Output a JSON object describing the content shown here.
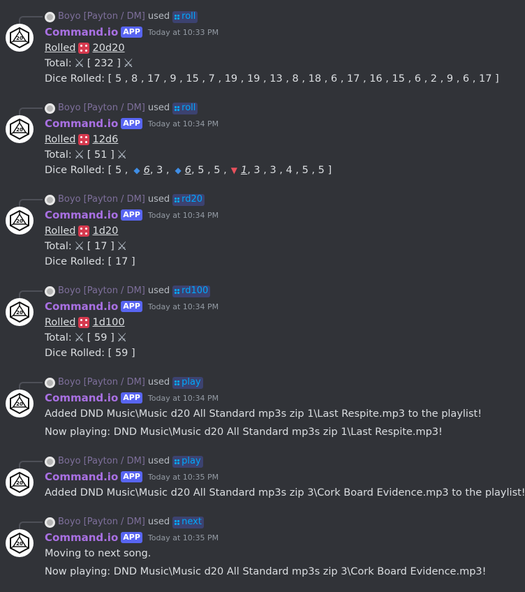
{
  "bot_name": "Command.io",
  "app_tag": "APP",
  "replied_user": "Boyo [Payton / DM]",
  "used_word": "used",
  "msgs": [
    {
      "command": "roll",
      "time": "Today at 10:33 PM",
      "rolled_label": "Rolled",
      "roll_expr": "20d20",
      "total_label": "Total:",
      "total": "[ 232 ]",
      "dice_label": "Dice Rolled:",
      "dice": "[ 5 ,  8 ,  17 ,  9 ,  15 ,  7 ,  19 ,  19 ,  13 ,  8 ,  18 ,  6 ,  17 ,  16 ,  15 ,  6 ,  2 ,  9 ,  6 ,  17 ]"
    },
    {
      "command": "roll",
      "time": "Today at 10:34 PM",
      "rolled_label": "Rolled",
      "roll_expr": "12d6",
      "total_label": "Total:",
      "total": "[ 51 ]",
      "dice_label": "Dice Rolled:",
      "dice_parts": [
        "[ 5 ,",
        "6",
        ", 3 ,",
        "6",
        ", 5 , 5 ,",
        "1",
        ", 3 , 3 , 4 , 5 , 5 ]"
      ]
    },
    {
      "command": "rd20",
      "time": "Today at 10:34 PM",
      "rolled_label": "Rolled",
      "roll_expr": "1d20",
      "total_label": "Total:",
      "total": "[ 17 ]",
      "dice_label": "Dice Rolled:",
      "dice": "[ 17 ]"
    },
    {
      "command": "rd100",
      "time": "Today at 10:34 PM",
      "rolled_label": "Rolled",
      "roll_expr": "1d100",
      "total_label": "Total:",
      "total": "[ 59 ]",
      "dice_label": "Dice Rolled:",
      "dice": "[ 59 ]"
    },
    {
      "command": "play",
      "time": "Today at 10:34 PM",
      "line1": "Added DND Music\\Music d20 All Standard mp3s zip 1\\Last Respite.mp3 to the playlist!",
      "line2": "Now playing: DND Music\\Music d20 All Standard mp3s zip 1\\Last Respite.mp3!"
    },
    {
      "command": "play",
      "time": "Today at 10:35 PM",
      "line1": "Added DND Music\\Music d20 All Standard mp3s zip 3\\Cork Board Evidence.mp3 to the playlist!"
    },
    {
      "command": "next",
      "time": "Today at 10:35 PM",
      "line1": "Moving to next song.",
      "line2": "Now playing: DND Music\\Music d20 All Standard mp3s zip 3\\Cork Board Evidence.mp3!"
    }
  ]
}
